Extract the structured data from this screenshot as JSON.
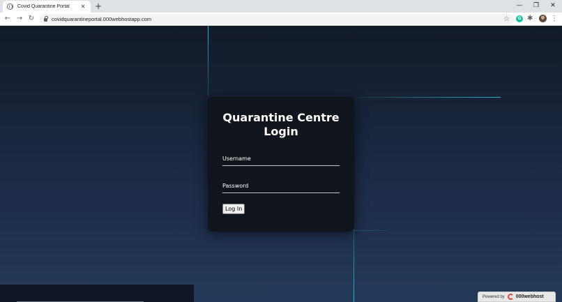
{
  "browser": {
    "tab_title": "Covid Quarantine Portal",
    "tab_close": "✕",
    "new_tab": "+",
    "url": "covidquarantineportal.000webhostapp.com",
    "extension_badge": "G",
    "window": {
      "minimize": "—",
      "restore": "❐",
      "close": "✕"
    },
    "nav": {
      "back": "←",
      "forward": "→",
      "reload": "↻"
    },
    "star": "☆",
    "puzzle": "✱",
    "menu": "⋮"
  },
  "login": {
    "title": "Quarantine Centre Login",
    "username_placeholder": "Username",
    "password_placeholder": "Password",
    "submit_label": "Log In"
  },
  "footer_badge": {
    "powered_by": "Powered by",
    "brand": "000webhost"
  },
  "colors": {
    "accent_line": "#2ab8c8",
    "card_bg": "#10151d",
    "page_bg_top": "#131b29",
    "page_bg_bottom": "#24395a"
  }
}
